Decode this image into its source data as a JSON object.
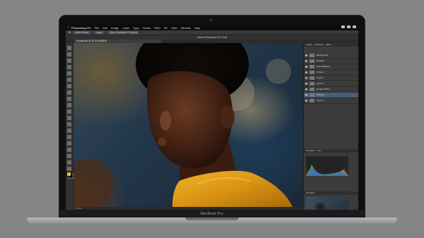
{
  "device": {
    "brand_label": "MacBook Pro"
  },
  "menubar": {
    "app_name": "Photoshop CC",
    "items": [
      "File",
      "Edit",
      "Image",
      "Layer",
      "Type",
      "Select",
      "Filter",
      "3D",
      "View",
      "Window",
      "Help"
    ]
  },
  "options": {
    "items": [
      "Auto-Select:",
      "Layer",
      "Show Transform Controls"
    ]
  },
  "document": {
    "title": "Adobe Photoshop CC 2018",
    "tab_label": "Portrait.psd @ 33.3% (RGB/8)",
    "status": "33.33%"
  },
  "panels": {
    "layers_tabs": [
      "Layers",
      "Channels",
      "Paths"
    ],
    "layers": [
      {
        "name": "Background"
      },
      {
        "name": "Retouch"
      },
      {
        "name": "Color Balance"
      },
      {
        "name": "Curves"
      },
      {
        "name": "Layer 1"
      },
      {
        "name": "Layer 2"
      },
      {
        "name": "Dodge & Burn"
      },
      {
        "name": "Sharpen"
      },
      {
        "name": "Layer 0"
      }
    ],
    "histogram_tabs": [
      "Histogram",
      "Info"
    ],
    "navigator_tabs": [
      "Navigator"
    ]
  },
  "colors": {
    "foreground": "#e5c23b",
    "background": "#111111",
    "selection": "#4a5d78"
  }
}
